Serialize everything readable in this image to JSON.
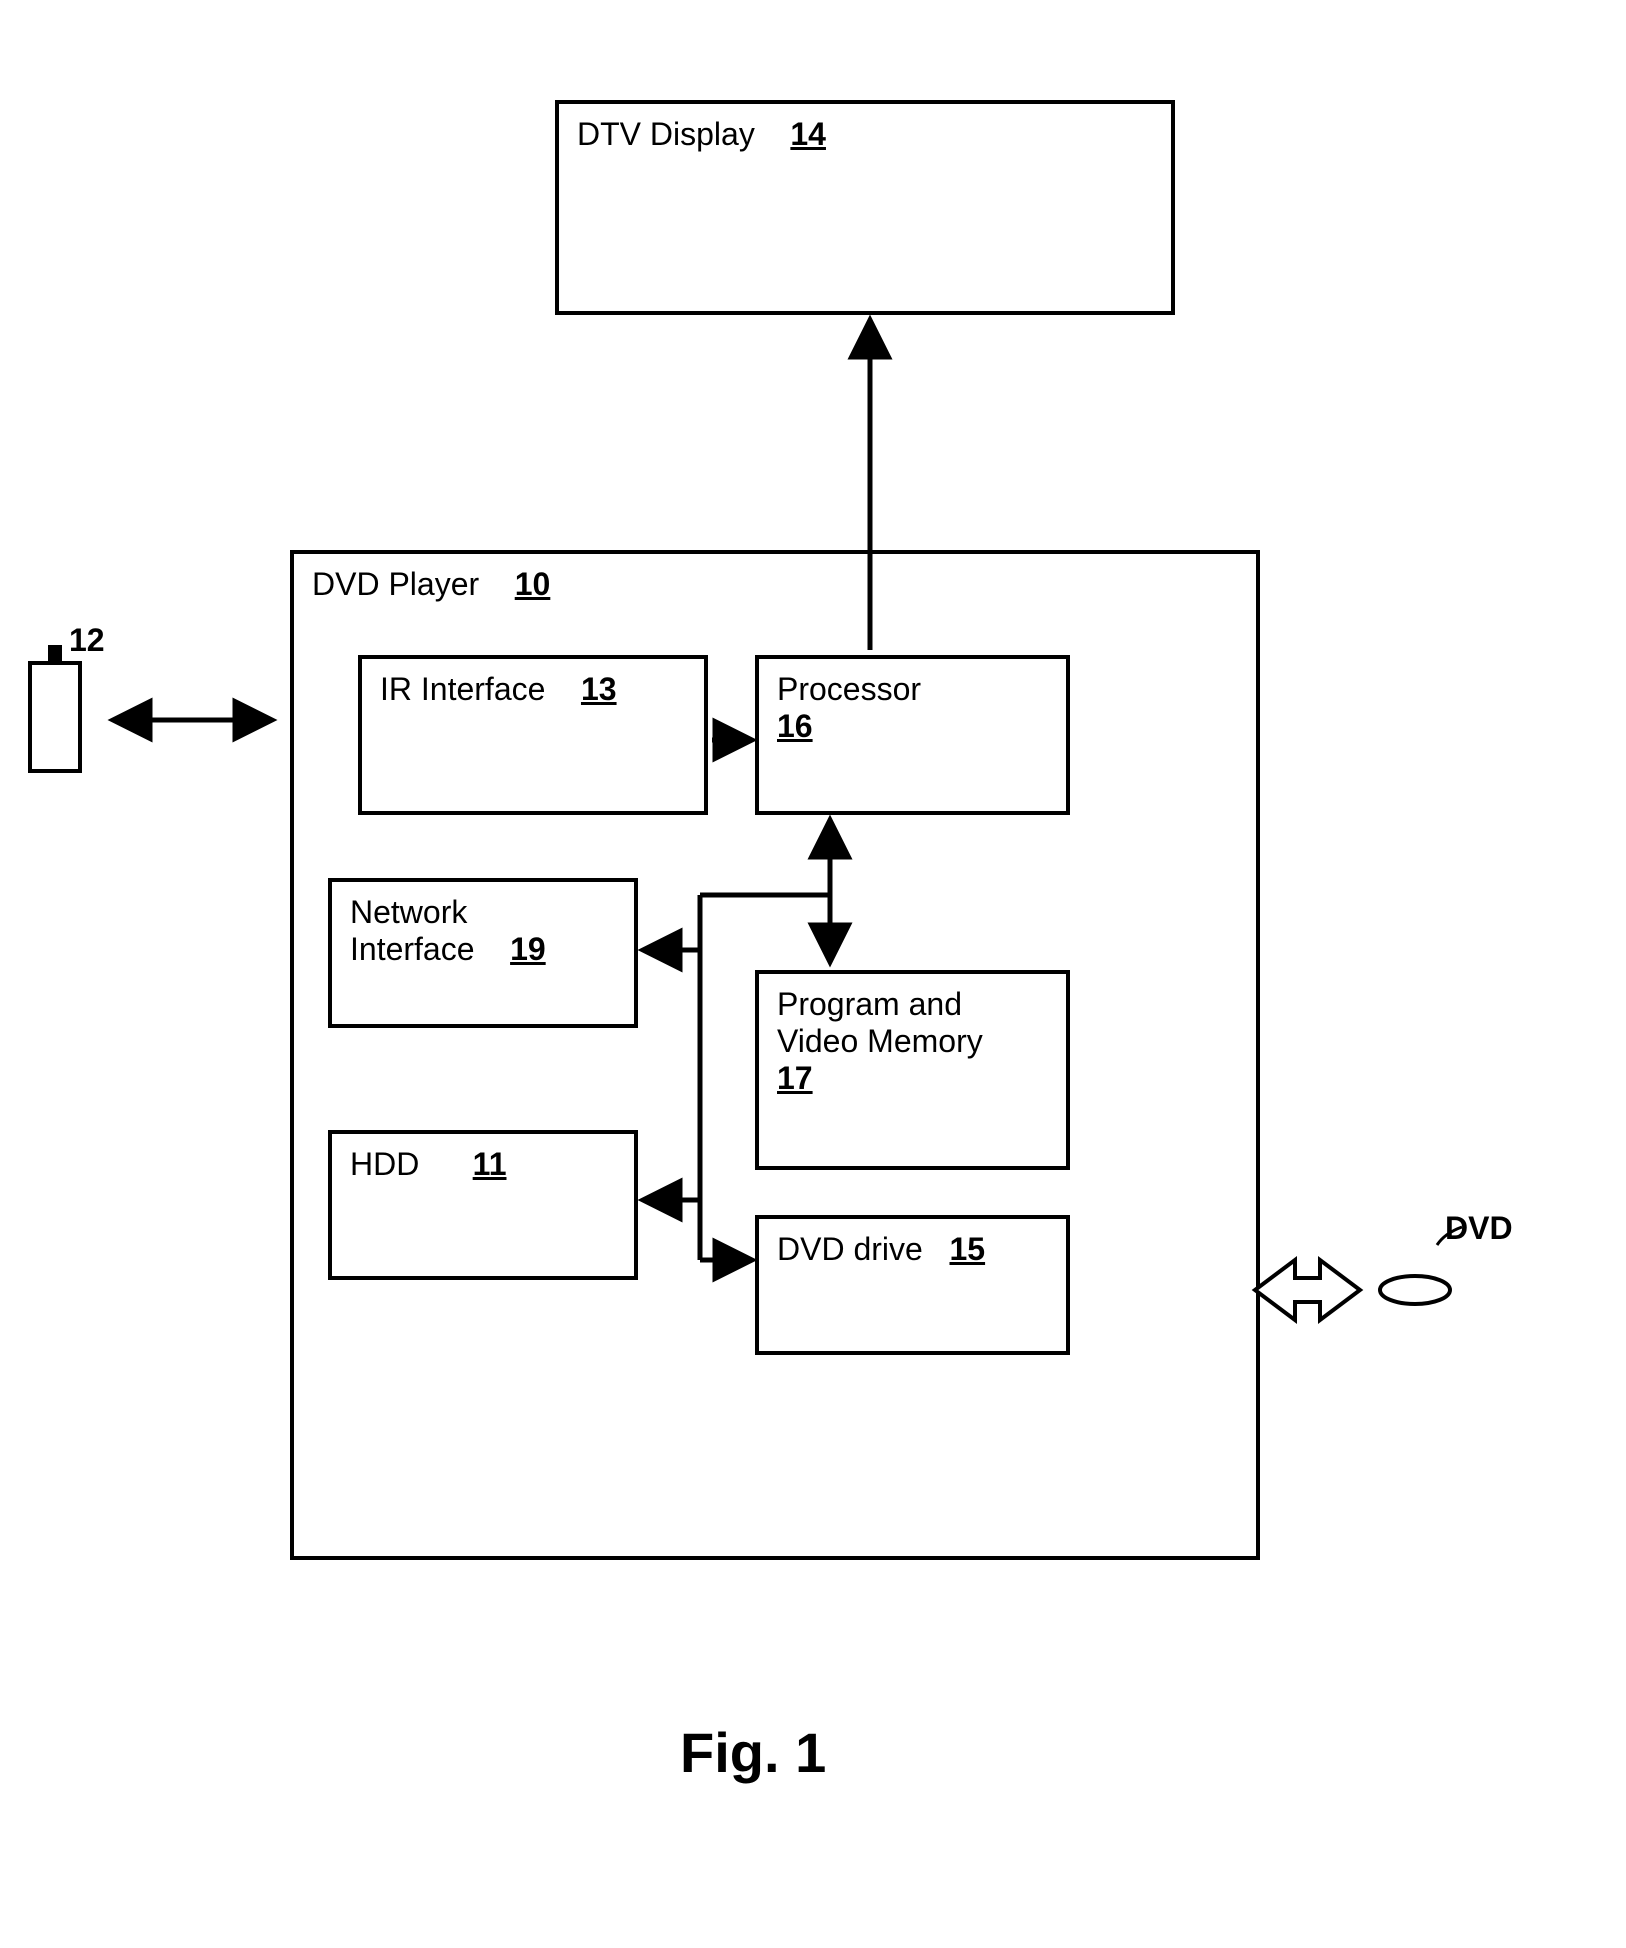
{
  "figure_caption": "Fig. 1",
  "labels": {
    "remote_num": "12",
    "dvd_caption": "DVD"
  },
  "boxes": {
    "dtv": {
      "title": "DTV Display",
      "num": "14"
    },
    "player": {
      "title": "DVD Player",
      "num": "10"
    },
    "ir": {
      "title": "IR Interface",
      "num": "13"
    },
    "proc": {
      "title": "Processor",
      "num": "16"
    },
    "net": {
      "title_line1": "Network",
      "title_line2": "Interface",
      "num": "19"
    },
    "mem": {
      "title_line1": "Program and",
      "title_line2": "Video Memory",
      "num": "17"
    },
    "hdd": {
      "title": "HDD",
      "num": "11"
    },
    "drive": {
      "title": "DVD drive",
      "num": "15"
    }
  }
}
